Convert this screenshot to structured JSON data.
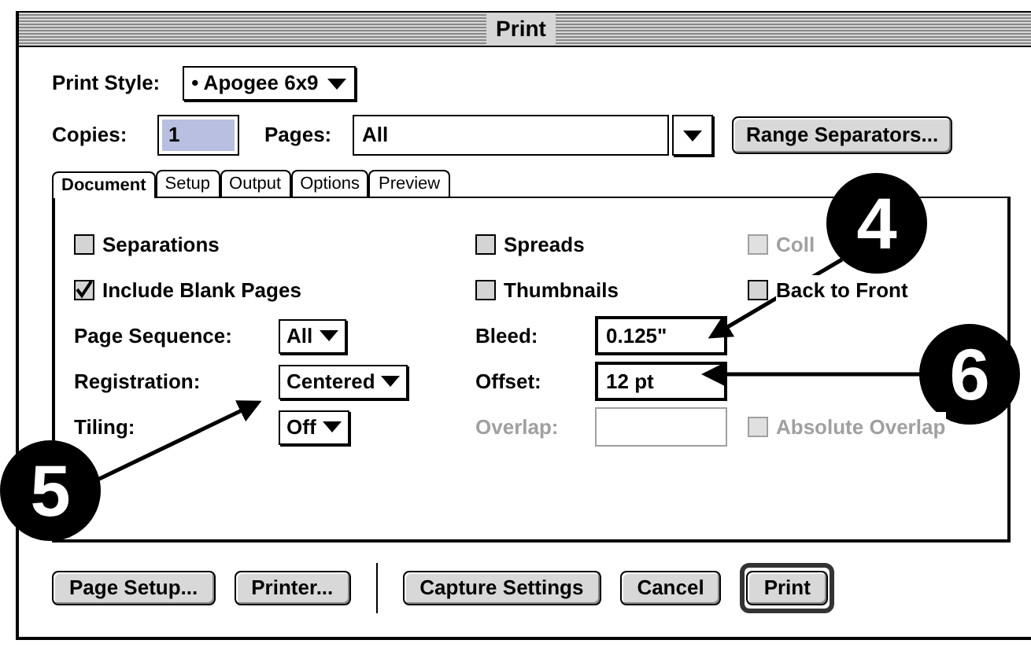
{
  "window": {
    "title": "Print"
  },
  "print_style": {
    "label": "Print Style:",
    "value": "• Apogee 6x9"
  },
  "copies": {
    "label": "Copies:",
    "value": "1"
  },
  "pages": {
    "label": "Pages:",
    "value": "All"
  },
  "range_button": "Range Separators...",
  "tabs": [
    {
      "label": "Document",
      "selected": true
    },
    {
      "label": "Setup",
      "selected": false
    },
    {
      "label": "Output",
      "selected": false
    },
    {
      "label": "Options",
      "selected": false
    },
    {
      "label": "Preview",
      "selected": false
    }
  ],
  "rows": [
    {
      "left": {
        "kind": "checkbox",
        "label": "Separations",
        "checked": false,
        "disabled": false
      },
      "middle": {
        "kind": "checkbox",
        "label": "Spreads",
        "checked": false,
        "disabled": false
      },
      "right": {
        "kind": "checkbox",
        "label": "Coll",
        "checked": false,
        "disabled": true
      }
    },
    {
      "left": {
        "kind": "checkbox",
        "label": "Include Blank Pages",
        "checked": true,
        "disabled": false
      },
      "middle": {
        "kind": "checkbox",
        "label": "Thumbnails",
        "checked": false,
        "disabled": false
      },
      "right": {
        "kind": "checkbox",
        "label": "Back to Front",
        "checked": false,
        "disabled": false
      }
    },
    {
      "left": {
        "kind": "popup",
        "label": "Page Sequence:",
        "value": "All"
      },
      "middle": {
        "kind": "field",
        "label": "Bleed:",
        "value": "0.125\"",
        "disabled": false
      }
    },
    {
      "left": {
        "kind": "popup",
        "label": "Registration:",
        "value": "Centered"
      },
      "middle": {
        "kind": "field",
        "label": "Offset:",
        "value": "12  pt",
        "disabled": false
      }
    },
    {
      "left": {
        "kind": "popup",
        "label": "Tiling:",
        "value": "Off"
      },
      "middle": {
        "kind": "field",
        "label": "Overlap:",
        "disabled": true
      },
      "right": {
        "kind": "checkbox",
        "label": "Absolute Overlap",
        "checked": false,
        "disabled": true
      }
    }
  ],
  "left_buttons": [
    {
      "label": "Page Setup...",
      "default": false
    },
    {
      "label": "Printer...",
      "default": false
    }
  ],
  "right_buttons": [
    {
      "label": "Capture Settings",
      "default": false
    },
    {
      "label": "Cancel",
      "default": false
    },
    {
      "label": "Print",
      "default": true
    }
  ],
  "callouts": [
    {
      "number": "4"
    },
    {
      "number": "5"
    },
    {
      "number": "6"
    }
  ]
}
